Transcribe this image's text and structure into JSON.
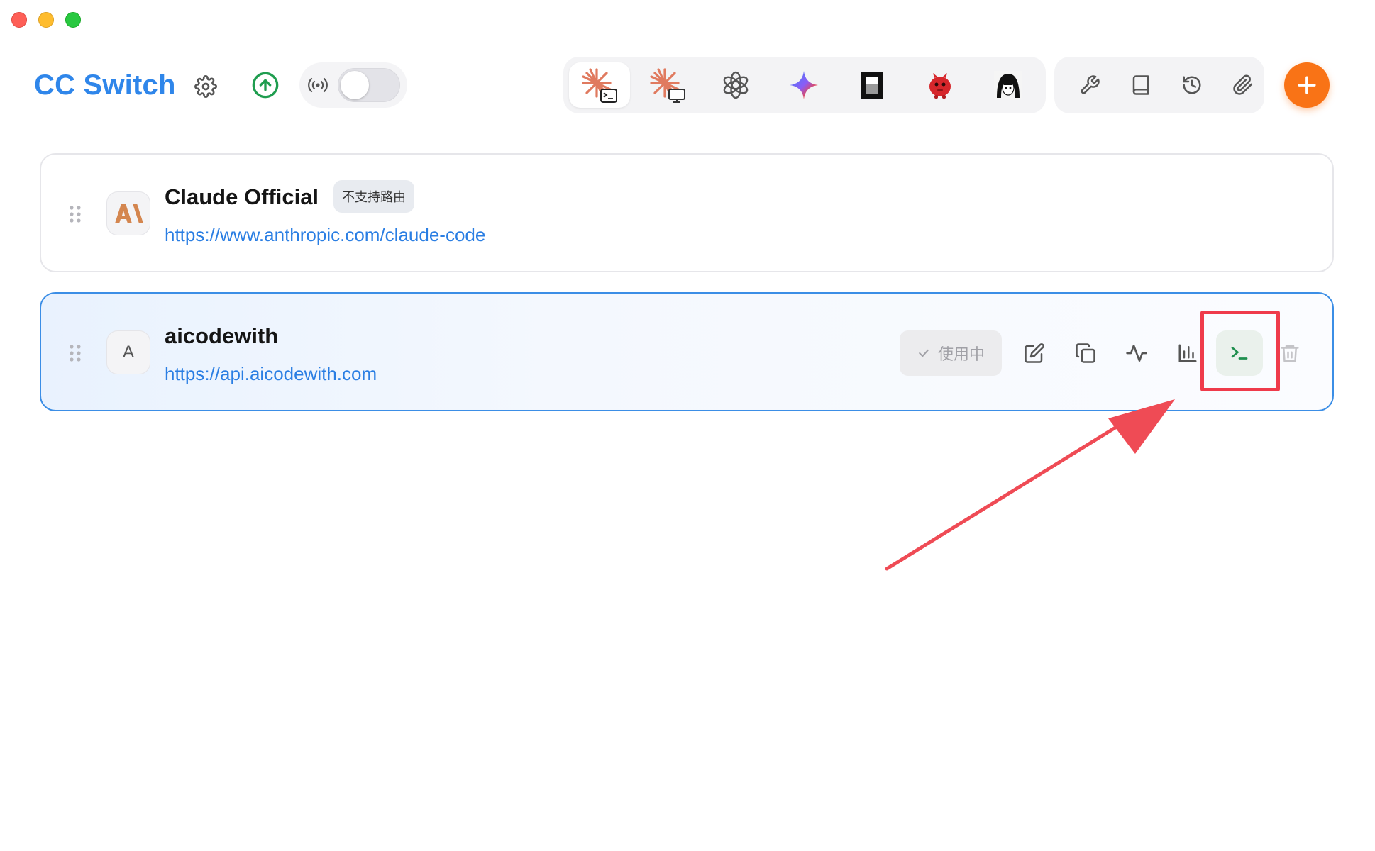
{
  "window": {
    "controls": [
      "close",
      "minimize",
      "zoom"
    ]
  },
  "header": {
    "title": "CC Switch",
    "icons": {
      "settings": "gear-icon",
      "update": "upload-circle-icon",
      "proxy": "broadcast-icon"
    },
    "proxy_toggle_on": false,
    "apps": [
      {
        "name": "claude-code",
        "icon": "claude-terminal-icon",
        "active": true
      },
      {
        "name": "claude-desktop",
        "icon": "claude-desktop-icon",
        "active": false
      },
      {
        "name": "openai",
        "icon": "openai-icon",
        "active": false
      },
      {
        "name": "gemini",
        "icon": "gemini-icon",
        "active": false
      },
      {
        "name": "opencode",
        "icon": "opencode-icon",
        "active": false
      },
      {
        "name": "red-creature",
        "icon": "red-creature-icon",
        "active": false
      },
      {
        "name": "anime-avatar",
        "icon": "anime-avatar-icon",
        "active": false
      }
    ],
    "tools": [
      "wrench-icon",
      "book-icon",
      "history-icon",
      "paperclip-icon"
    ],
    "add_icon": "plus-icon"
  },
  "providers": [
    {
      "name": "Claude Official",
      "url": "https://www.anthropic.com/claude-code",
      "badge": "不支持路由",
      "avatar": "anthropic-logo"
    },
    {
      "name": "aicodewith",
      "url": "https://api.aicodewith.com",
      "avatar_letter": "A",
      "status_label": "使用中",
      "actions": [
        "edit-icon",
        "copy-icon",
        "activity-icon",
        "bar-chart-icon",
        "terminal-icon",
        "trash-icon"
      ]
    }
  ],
  "colors": {
    "brand": "#2f86ea",
    "add_button": "#f97316",
    "annotation": "#ef3b4b",
    "terminal_green": "#1f8f4e"
  }
}
